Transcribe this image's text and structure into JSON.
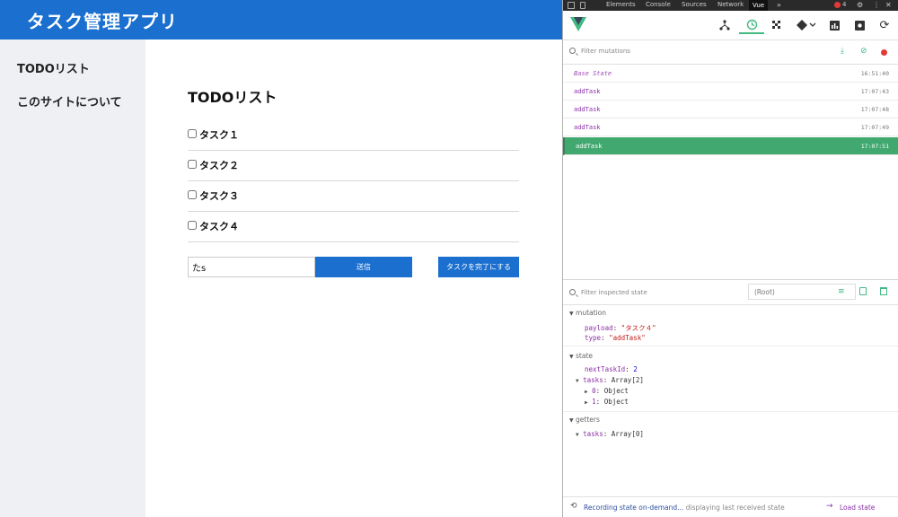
{
  "app": {
    "title": "タスク管理アプリ",
    "nav": [
      "TODOリスト",
      "このサイトについて"
    ],
    "page_title": "TODOリスト",
    "tasks": [
      "タスク１",
      "タスク２",
      "タスク３",
      "タスク４"
    ],
    "input_value": "たs",
    "submit_label": "送信",
    "complete_label": "タスクを完了にする",
    "header_color": "#1a6fcf"
  },
  "devtools": {
    "tabs": [
      "Elements",
      "Console",
      "Sources",
      "Network",
      "Vue"
    ],
    "active_tab": "Vue",
    "more_glyph": "»",
    "error_count": "4",
    "toolbar_icons": [
      "components-icon",
      "history-icon",
      "performance-icon",
      "routing-icon",
      "stats-icon",
      "settings-icon",
      "refresh-icon"
    ],
    "filter_mutations_placeholder": "Filter mutations",
    "mutations": [
      {
        "name": "Base State",
        "time": "16:51:40"
      },
      {
        "name": "addTask",
        "time": "17:07:43"
      },
      {
        "name": "addTask",
        "time": "17:07:48"
      },
      {
        "name": "addTask",
        "time": "17:07:49"
      },
      {
        "name": "addTask",
        "time": "17:07:51"
      }
    ],
    "selected_index": 4,
    "filter_state_placeholder": "Filter inspected state",
    "root_label": "(Root)",
    "mutation_section": {
      "title": "mutation",
      "payload_key": "payload",
      "payload_value": "\"タスク４\"",
      "type_key": "type",
      "type_value": "\"addTask\""
    },
    "state_section": {
      "title": "state",
      "next_key": "nextTaskId",
      "next_value": "2",
      "tasks_key": "tasks",
      "tasks_value": "Array[2]",
      "item0_key": "0",
      "item0_value": "Object",
      "item1_key": "1",
      "item1_value": "Object"
    },
    "getters_section": {
      "title": "getters",
      "tasks_key": "tasks",
      "tasks_value": "Array[0]"
    },
    "footer": {
      "recording": "Recording state on-demand...",
      "displaying": "displaying last received state",
      "load": "Load state"
    },
    "accent": "#42b983",
    "selected_bg": "#41a970"
  }
}
